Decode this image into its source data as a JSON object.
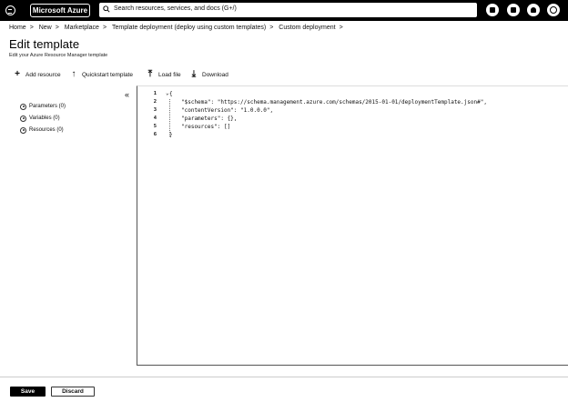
{
  "topbar": {
    "brand": "Microsoft Azure",
    "search_placeholder": "Search resources, services, and docs (G+/)",
    "icons": [
      "cloud-shell-icon",
      "feedback-icon",
      "bell-icon",
      "settings-icon"
    ]
  },
  "breadcrumb": [
    "Home",
    "New",
    "Marketplace",
    "Template deployment (deploy using custom templates)",
    "Custom deployment"
  ],
  "page": {
    "title": "Edit template",
    "subtitle": "Edit your Azure Resource Manager template"
  },
  "toolbar": {
    "add_resource": "Add resource",
    "quickstart": "Quickstart template",
    "load_file": "Load file",
    "download": "Download"
  },
  "tree": {
    "collapse_glyph": "«",
    "items": [
      {
        "label": "Parameters (0)"
      },
      {
        "label": "Variables (0)"
      },
      {
        "label": "Resources (0)"
      }
    ]
  },
  "editor": {
    "lines": [
      {
        "num": "1",
        "text": "{"
      },
      {
        "num": "2",
        "text": "\"$schema\": \"https://schema.management.azure.com/schemas/2015-01-01/deploymentTemplate.json#\","
      },
      {
        "num": "3",
        "text": "\"contentVersion\": \"1.0.0.0\","
      },
      {
        "num": "4",
        "text": "\"parameters\": {},"
      },
      {
        "num": "5",
        "text": "\"resources\": []"
      },
      {
        "num": "6",
        "text": "}"
      }
    ]
  },
  "footer": {
    "save": "Save",
    "discard": "Discard"
  }
}
